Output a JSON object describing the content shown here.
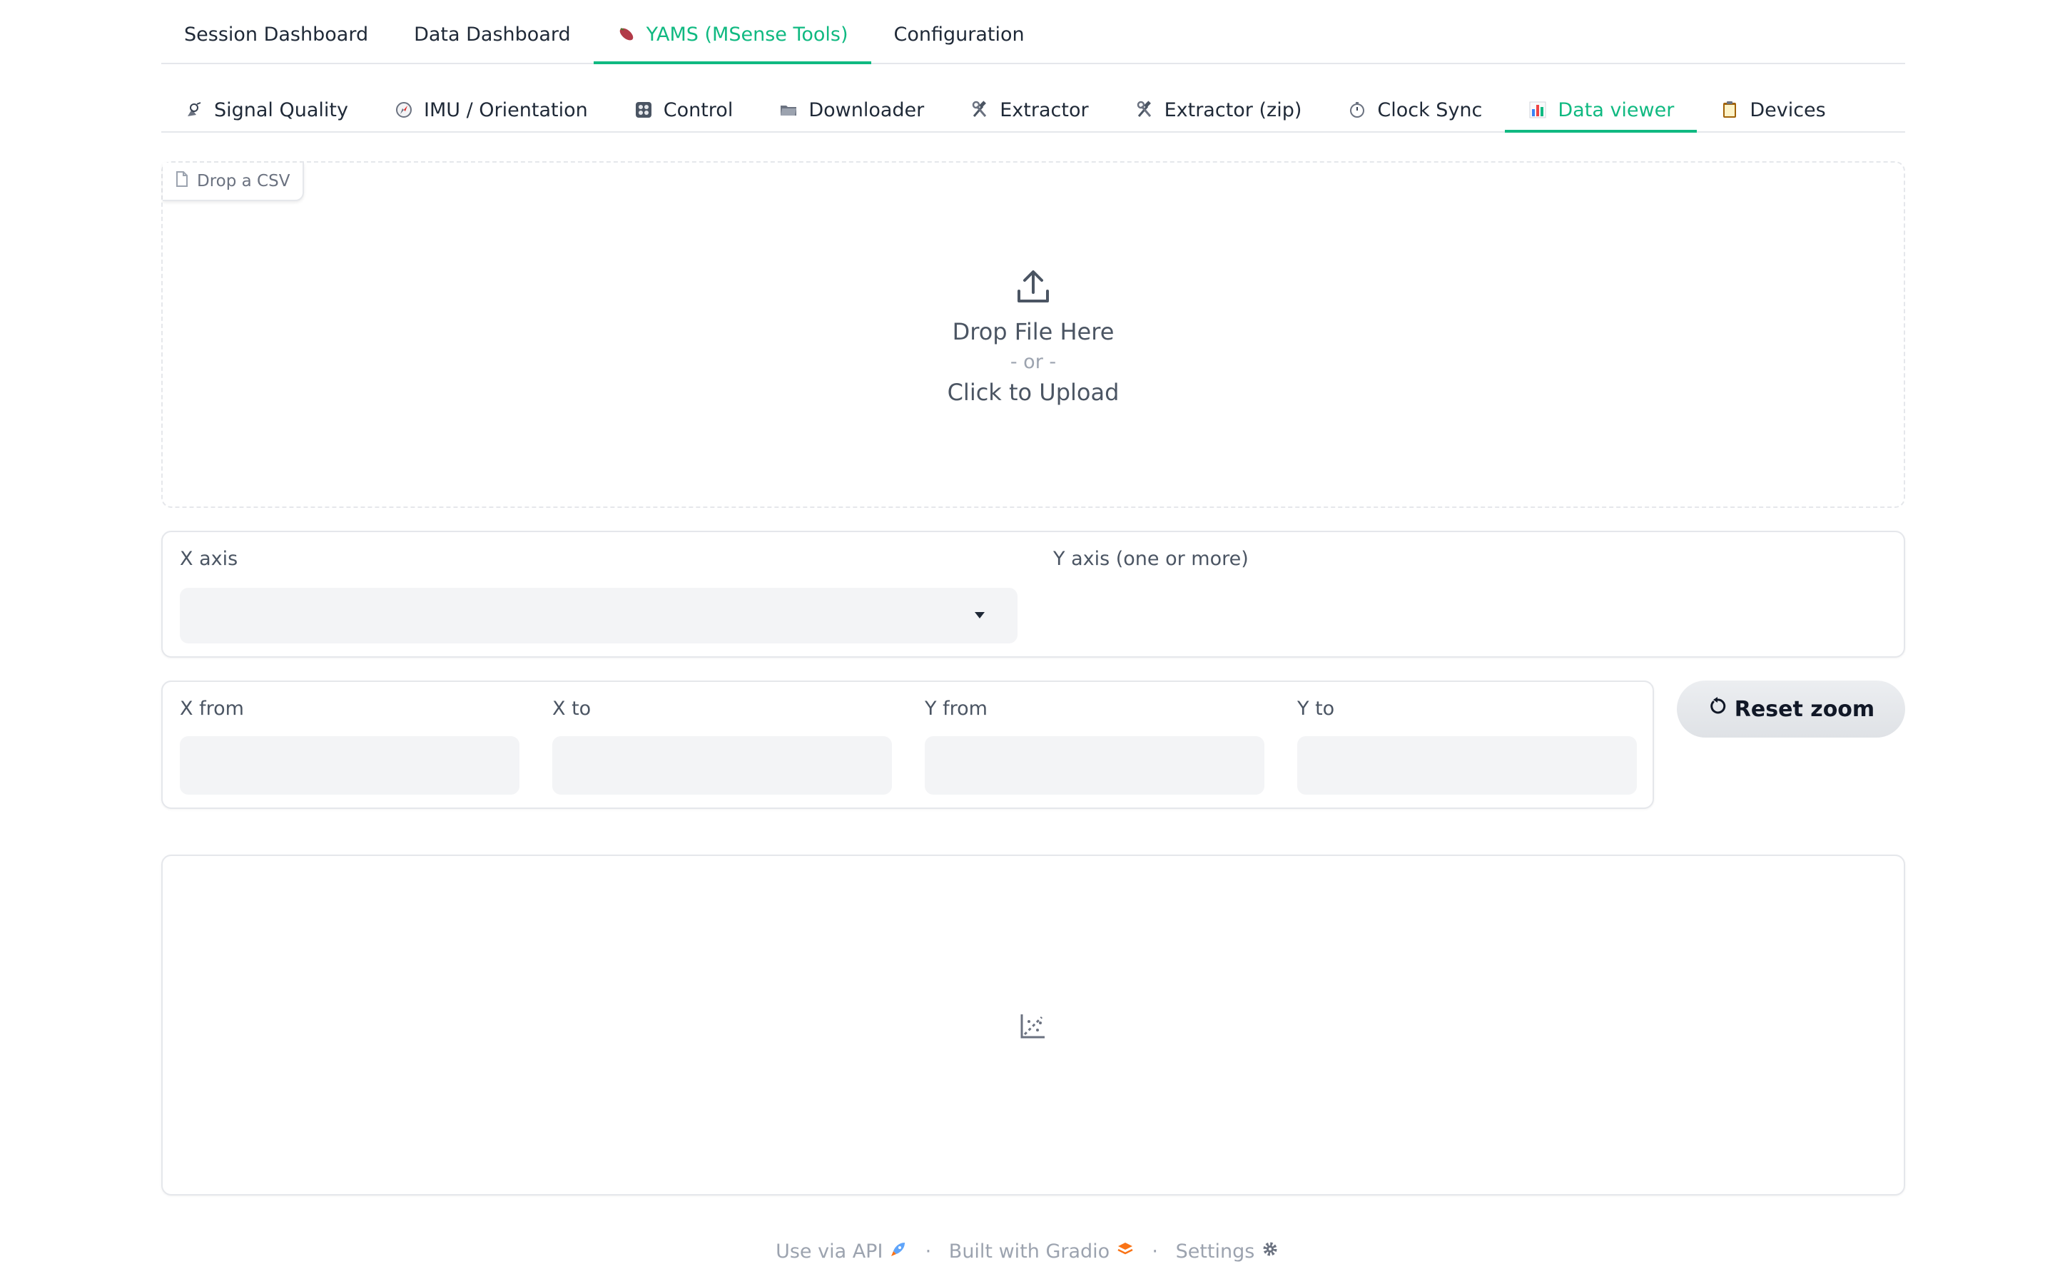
{
  "top_tabs": [
    {
      "label": "Session Dashboard"
    },
    {
      "label": "Data Dashboard"
    },
    {
      "label": "YAMS (MSense Tools)",
      "icon": "sweet-potato-icon",
      "active": true
    },
    {
      "label": "Configuration"
    }
  ],
  "sub_tabs": [
    {
      "label": "Signal Quality",
      "icon": "satellite-antenna-icon"
    },
    {
      "label": "IMU / Orientation",
      "icon": "compass-icon"
    },
    {
      "label": "Control",
      "icon": "control-knobs-icon"
    },
    {
      "label": "Downloader",
      "icon": "folder-icon"
    },
    {
      "label": "Extractor",
      "icon": "hammer-wrench-icon"
    },
    {
      "label": "Extractor (zip)",
      "icon": "hammer-wrench-icon"
    },
    {
      "label": "Clock Sync",
      "icon": "stopwatch-icon"
    },
    {
      "label": "Data viewer",
      "icon": "bar-chart-icon",
      "active": true
    },
    {
      "label": "Devices",
      "icon": "clipboard-icon"
    }
  ],
  "upload": {
    "label": "Drop a CSV",
    "drop_text": "Drop File Here",
    "or_text": "- or -",
    "click_text": "Click to Upload"
  },
  "axes": {
    "x_label": "X axis",
    "x_value": "",
    "y_label": "Y axis (one or more)"
  },
  "range": {
    "x_from_label": "X from",
    "x_to_label": "X to",
    "y_from_label": "Y from",
    "y_to_label": "Y to",
    "reset_label": "Reset zoom"
  },
  "footer": {
    "api": "Use via API",
    "built": "Built with Gradio",
    "settings": "Settings"
  },
  "colors": {
    "accent": "#10b981"
  }
}
